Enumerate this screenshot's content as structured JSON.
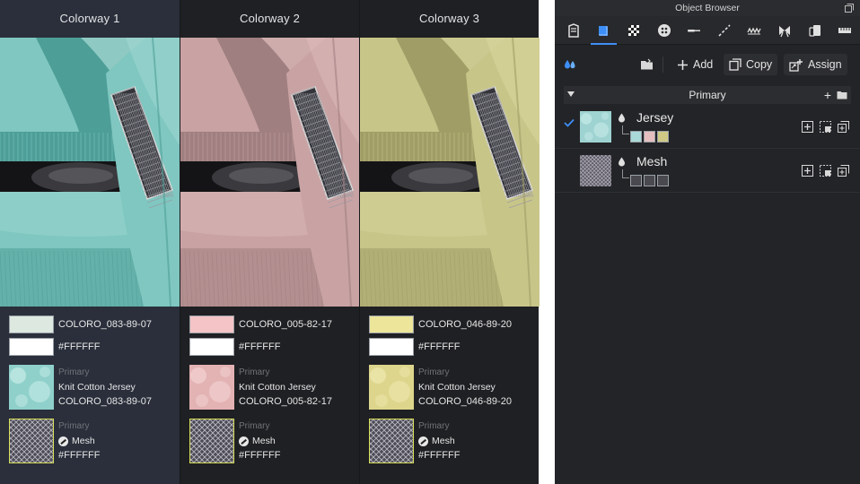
{
  "colorways": [
    {
      "title": "Colorway 1",
      "active": true,
      "color": "#7fc7c0",
      "color_dark": "#4e9e98",
      "color_light": "#a9dcd6",
      "swatches": [
        {
          "hex": "#dde8e1",
          "label": "COLORO_083-89-07"
        },
        {
          "hex": "#ffffff",
          "label": "#FFFFFF"
        }
      ],
      "materials": [
        {
          "category": "Primary",
          "name": "Knit Cotton Jersey",
          "code": "COLORO_083-89-07",
          "type": "jersey"
        },
        {
          "category": "Primary",
          "name": "Mesh",
          "code": "#FFFFFF",
          "type": "mesh"
        }
      ]
    },
    {
      "title": "Colorway 2",
      "active": false,
      "color": "#c9a3a4",
      "color_dark": "#a07f80",
      "color_light": "#e2bfbf",
      "swatches": [
        {
          "hex": "#f4c4c6",
          "label": "COLORO_005-82-17"
        },
        {
          "hex": "#ffffff",
          "label": "#FFFFFF"
        }
      ],
      "materials": [
        {
          "category": "Primary",
          "name": "Knit Cotton Jersey",
          "code": "COLORO_005-82-17",
          "type": "jersey"
        },
        {
          "category": "Primary",
          "name": "Mesh",
          "code": "#FFFFFF",
          "type": "mesh"
        }
      ]
    },
    {
      "title": "Colorway 3",
      "active": false,
      "color": "#c8c589",
      "color_dark": "#a09d66",
      "color_light": "#dedba2",
      "swatches": [
        {
          "hex": "#ede69a",
          "label": "COLORO_046-89-20"
        },
        {
          "hex": "#ffffff",
          "label": "#FFFFFF"
        }
      ],
      "materials": [
        {
          "category": "Primary",
          "name": "Knit Cotton Jersey",
          "code": "COLORO_046-89-20",
          "type": "jersey"
        },
        {
          "category": "Primary",
          "name": "Mesh",
          "code": "#FFFFFF",
          "type": "mesh"
        }
      ]
    }
  ],
  "object_browser": {
    "title": "Object Browser",
    "tabs": [
      {
        "icon": "garment-icon",
        "active": false
      },
      {
        "icon": "fabric-icon",
        "active": true
      },
      {
        "icon": "checker-icon",
        "active": false
      },
      {
        "icon": "button-icon",
        "active": false
      },
      {
        "icon": "buttonhole-icon",
        "active": false
      },
      {
        "icon": "topstitch-icon",
        "active": false
      },
      {
        "icon": "zipper-icon",
        "active": false
      },
      {
        "icon": "bow-icon",
        "active": false
      },
      {
        "icon": "trim-icon",
        "active": false
      },
      {
        "icon": "ruler-icon",
        "active": false
      }
    ],
    "toolbar": {
      "add_label": "Add",
      "copy_label": "Copy",
      "assign_label": "Assign"
    },
    "section": {
      "label": "Primary"
    },
    "items": [
      {
        "name": "Jersey",
        "checked": true,
        "thumb": "#9ed3d2",
        "swatches": [
          "#a9d9d8",
          "#e5bfbf",
          "#cfc985"
        ]
      },
      {
        "name": "Mesh",
        "checked": false,
        "thumb": "#5e5a66",
        "swatches": [
          "#4a4950",
          "#4a4950",
          "#4a4950"
        ]
      }
    ]
  }
}
